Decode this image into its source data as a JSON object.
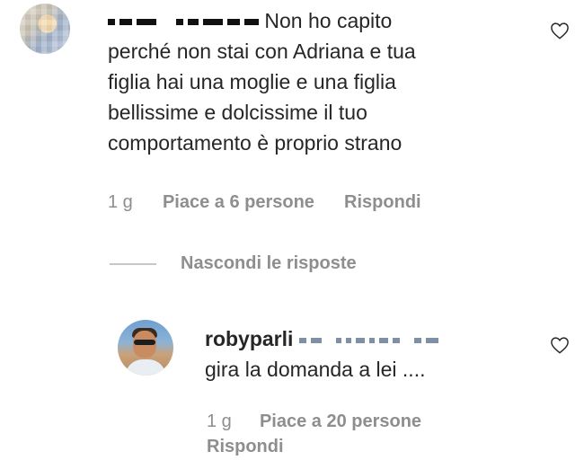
{
  "comment": {
    "text_line1": "Non ho capito",
    "text_line2": "perché non stai con Adriana e tua",
    "text_line3": "figlia hai una moglie e una figlia",
    "text_line4": "bellissime e dolcissime il tuo",
    "text_line5": "comportamento è proprio strano",
    "time": "1 g",
    "likes": "Piace a 6 persone",
    "reply": "Rispondi"
  },
  "toggle_replies": "Nascondi le risposte",
  "reply_comment": {
    "username": "robyparli",
    "text": "gira la domanda a lei ....",
    "time": "1 g",
    "likes": "Piace a 20 persone",
    "reply": "Rispondi"
  },
  "icons": {
    "like": "heart-outline-icon"
  },
  "colors": {
    "text": "#262626",
    "meta": "#8e8e8e"
  }
}
